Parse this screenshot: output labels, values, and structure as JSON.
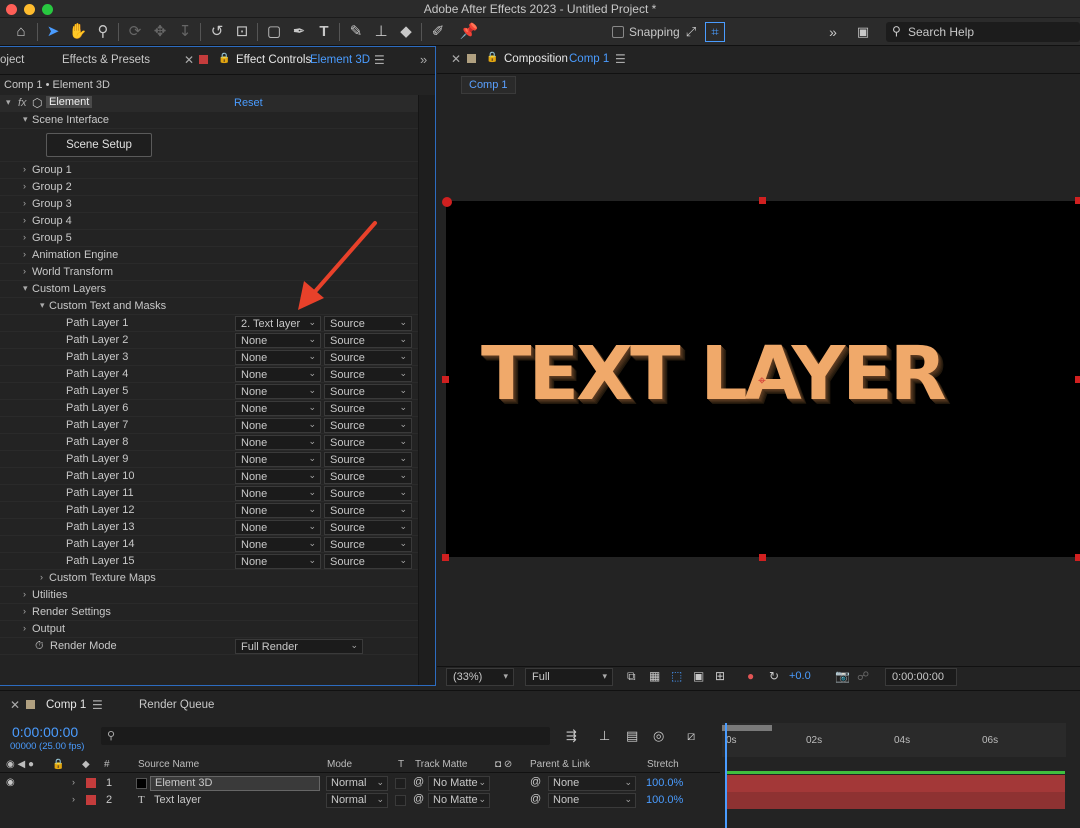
{
  "window": {
    "title": "Adobe After Effects 2023 - Untitled Project *"
  },
  "toolbar": {
    "snapping_label": "Snapping",
    "search_placeholder": "Search Help",
    "icons": [
      "home-icon",
      "selection-tool-icon",
      "hand-tool-icon",
      "zoom-tool-icon",
      "orbit-icon",
      "pan-icon",
      "dolly-icon",
      "rotate-tool-icon",
      "pan-behind-icon",
      "rectangle-tool-icon",
      "pen-tool-icon",
      "type-tool-icon",
      "brush-tool-icon",
      "clone-stamp-icon",
      "eraser-tool-icon",
      "roto-brush-icon",
      "puppet-pin-icon"
    ]
  },
  "left_panel": {
    "tabs": {
      "project": "oject",
      "effects": "Effects & Presets",
      "effect_controls": "Effect Controls",
      "effect_layer": "Element 3D"
    },
    "subheader": "Comp 1 • Element 3D",
    "effect_name": "Element",
    "reset_label": "Reset",
    "scene_interface": "Scene Interface",
    "scene_setup_button": "Scene Setup",
    "groups": [
      "Group 1",
      "Group 2",
      "Group 3",
      "Group 4",
      "Group 5"
    ],
    "animation_engine": "Animation Engine",
    "world_transform": "World Transform",
    "custom_layers": "Custom Layers",
    "custom_text_masks": "Custom Text and Masks",
    "path_layers": [
      {
        "label": "Path Layer 1",
        "layer": "2. Text layer",
        "source": "Source"
      },
      {
        "label": "Path Layer 2",
        "layer": "None",
        "source": "Source"
      },
      {
        "label": "Path Layer 3",
        "layer": "None",
        "source": "Source"
      },
      {
        "label": "Path Layer 4",
        "layer": "None",
        "source": "Source"
      },
      {
        "label": "Path Layer 5",
        "layer": "None",
        "source": "Source"
      },
      {
        "label": "Path Layer 6",
        "layer": "None",
        "source": "Source"
      },
      {
        "label": "Path Layer 7",
        "layer": "None",
        "source": "Source"
      },
      {
        "label": "Path Layer 8",
        "layer": "None",
        "source": "Source"
      },
      {
        "label": "Path Layer 9",
        "layer": "None",
        "source": "Source"
      },
      {
        "label": "Path Layer 10",
        "layer": "None",
        "source": "Source"
      },
      {
        "label": "Path Layer 11",
        "layer": "None",
        "source": "Source"
      },
      {
        "label": "Path Layer 12",
        "layer": "None",
        "source": "Source"
      },
      {
        "label": "Path Layer 13",
        "layer": "None",
        "source": "Source"
      },
      {
        "label": "Path Layer 14",
        "layer": "None",
        "source": "Source"
      },
      {
        "label": "Path Layer 15",
        "layer": "None",
        "source": "Source"
      }
    ],
    "custom_texture_maps": "Custom Texture Maps",
    "utilities": "Utilities",
    "render_settings": "Render Settings",
    "output": "Output",
    "render_mode_label": "Render Mode",
    "render_mode_value": "Full Render"
  },
  "comp_panel": {
    "tab_prefix": "Composition",
    "tab_comp": "Comp 1",
    "subtab": "Comp 1",
    "canvas_text": "TEXT LAYER",
    "zoom": "(33%)",
    "resolution": "Full",
    "exposure": "+0.0",
    "timecode": "0:00:00:00"
  },
  "timeline": {
    "tab_comp": "Comp 1",
    "tab_render_queue": "Render Queue",
    "timecode": "0:00:00:00",
    "frames": "00000 (25.00 fps)",
    "columns": {
      "num": "#",
      "source": "Source Name",
      "mode": "Mode",
      "t": "T",
      "track_matte": "Track Matte",
      "parent": "Parent & Link",
      "stretch": "Stretch"
    },
    "ruler_ticks": [
      "0s",
      "02s",
      "04s",
      "06s"
    ],
    "layers": [
      {
        "num": "1",
        "name": "Element 3D",
        "mode": "Normal",
        "matte": "No Matte",
        "parent": "None",
        "stretch": "100.0%"
      },
      {
        "num": "2",
        "name": "Text layer",
        "mode": "Normal",
        "matte": "No Matte",
        "parent": "None",
        "stretch": "100.0%"
      }
    ]
  },
  "colors": {
    "accent": "#4a9cff",
    "handle": "#d02020",
    "track": "#a33838",
    "annotation_arrow": "#e8412a",
    "label_red": "#c43c3c"
  }
}
